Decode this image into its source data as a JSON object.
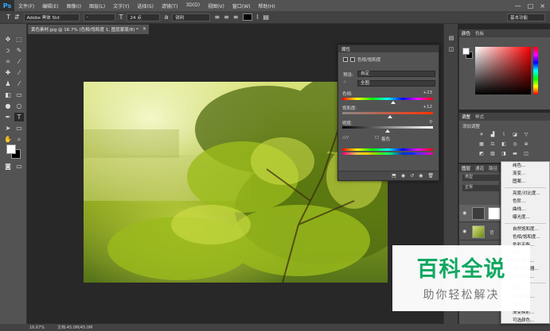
{
  "app": {
    "logo": "Ps"
  },
  "menu": [
    "文件(F)",
    "编辑(E)",
    "图像(I)",
    "图层(L)",
    "文字(Y)",
    "选择(S)",
    "滤镜(T)",
    "3D(D)",
    "视图(V)",
    "窗口(W)",
    "帮助(H)"
  ],
  "window_controls": [
    "—",
    "□",
    "×"
  ],
  "options_bar": {
    "font_family": "Adobe 黑体 Std",
    "font_style": "-",
    "font_size": "24 点",
    "anti_alias": "锐利",
    "text_color": "#000000",
    "workspace": "基本功能"
  },
  "document": {
    "tab_title": "黄色素材.jpg @ 16.7% (色相/饱和度 1, 图层蒙版/8) *",
    "close": "×",
    "zoom": "16.67%",
    "doc_size": "文档:45.0M/45.0M"
  },
  "properties": {
    "panel_title": "属性",
    "type": "色相/饱和度",
    "preset_label": "预设:",
    "preset_value": "自定",
    "channel_value": "全图",
    "hue_label": "色相:",
    "hue_value": "+23",
    "hue_level": 0.56,
    "saturation_label": "饱和度:",
    "saturation_value": "+12",
    "saturation_level": 0.53,
    "lightness_label": "明度:",
    "lightness_value": "0",
    "lightness_level": 0.5,
    "colorize_label": "着色"
  },
  "right_panels": {
    "color_tabs": [
      "颜色",
      "色板"
    ],
    "adjust_tabs": [
      "调整",
      "样式"
    ],
    "adjust_title": "添加调整",
    "layer_tabs": [
      "图层",
      "通道",
      "路径"
    ],
    "layer_kind": "类型",
    "blend_mode": "正常",
    "bg_layer_label": "背"
  },
  "context_menu": [
    "纯色...",
    "渐变...",
    "图案...",
    "-",
    "亮度/对比度...",
    "色阶...",
    "曲线...",
    "曝光度...",
    "-",
    "自然饱和度...",
    "色相/饱和度...",
    "色彩平衡...",
    "黑白...",
    "照片滤镜...",
    "通道混合器...",
    "颜色查找...",
    "-",
    "反相",
    "色调分离...",
    "阈值...",
    "渐变映射...",
    "可选颜色..."
  ],
  "watermark": {
    "title": "百科全说",
    "subtitle": "助你轻松解决"
  }
}
